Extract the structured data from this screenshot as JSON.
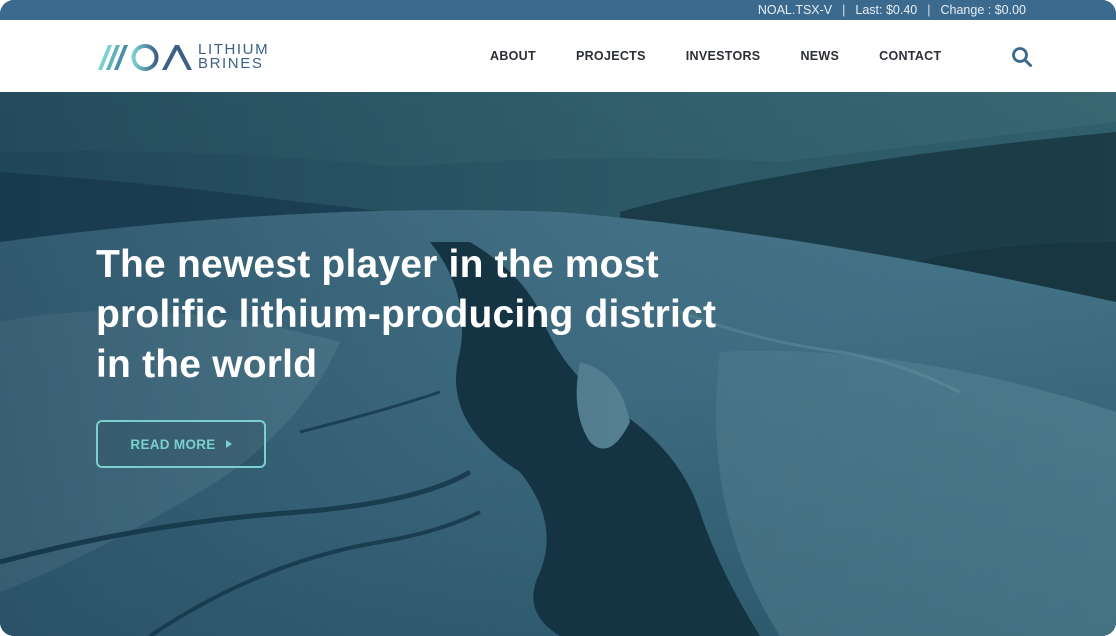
{
  "ticker": {
    "symbol": "NOAL.TSX-V",
    "last": "Last: $0.40",
    "change": "Change : $0.00",
    "separator": "|"
  },
  "brand": {
    "logo_mark_text": "NOA",
    "line1": "LITHIUM",
    "line2": "BRINES"
  },
  "nav": {
    "items": [
      {
        "label": "ABOUT"
      },
      {
        "label": "PROJECTS"
      },
      {
        "label": "INVESTORS"
      },
      {
        "label": "NEWS"
      },
      {
        "label": "CONTACT"
      }
    ],
    "search_icon": "search-icon"
  },
  "hero": {
    "headline_lines": [
      "The newest player in the most",
      "prolific lithium-producing district",
      "in the world"
    ],
    "cta_label": "READ MORE",
    "cta_icon": "caret-right-icon"
  },
  "colors": {
    "ticker_bg": "#3c6a8e",
    "brand_blue": "#3c5f86",
    "brand_teal": "#7ad0cf",
    "hero_tint": "#1f4a5e"
  }
}
